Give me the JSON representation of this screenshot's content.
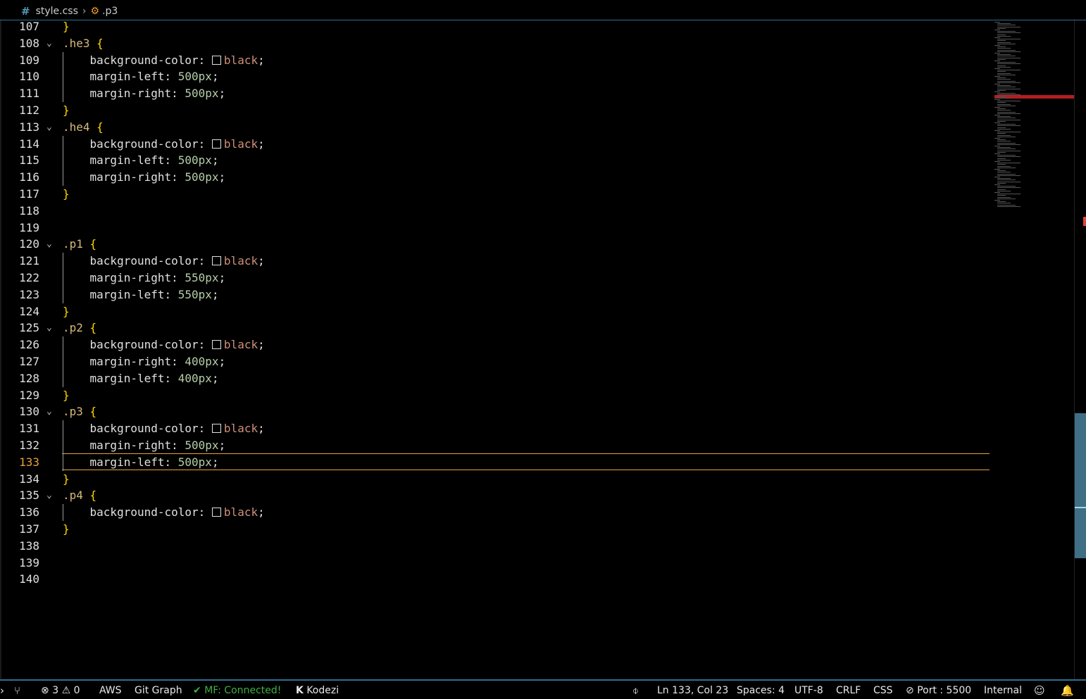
{
  "breadcrumb": {
    "file": "style.css",
    "symbol": ".p3",
    "file_icon": "hash-icon",
    "symbol_icon": "class-symbol-icon"
  },
  "editor": {
    "active_line": "133",
    "lines": [
      {
        "n": "107",
        "kind": "close"
      },
      {
        "n": "108",
        "kind": "open",
        "sel": ".he3"
      },
      {
        "n": "109",
        "kind": "bg",
        "prop": "background-color",
        "val": "black"
      },
      {
        "n": "110",
        "kind": "num",
        "prop": "margin-left",
        "val": "500px"
      },
      {
        "n": "111",
        "kind": "num",
        "prop": "margin-right",
        "val": "500px"
      },
      {
        "n": "112",
        "kind": "close"
      },
      {
        "n": "113",
        "kind": "open",
        "sel": ".he4"
      },
      {
        "n": "114",
        "kind": "bg",
        "prop": "background-color",
        "val": "black"
      },
      {
        "n": "115",
        "kind": "num",
        "prop": "margin-left",
        "val": "500px"
      },
      {
        "n": "116",
        "kind": "num",
        "prop": "margin-right",
        "val": "500px"
      },
      {
        "n": "117",
        "kind": "close"
      },
      {
        "n": "118",
        "kind": "blank"
      },
      {
        "n": "119",
        "kind": "blank"
      },
      {
        "n": "120",
        "kind": "open",
        "sel": ".p1"
      },
      {
        "n": "121",
        "kind": "bg",
        "prop": "background-color",
        "val": "black"
      },
      {
        "n": "122",
        "kind": "num",
        "prop": "margin-right",
        "val": "550px"
      },
      {
        "n": "123",
        "kind": "num",
        "prop": "margin-left",
        "val": "550px"
      },
      {
        "n": "124",
        "kind": "close"
      },
      {
        "n": "125",
        "kind": "open",
        "sel": ".p2"
      },
      {
        "n": "126",
        "kind": "bg",
        "prop": "background-color",
        "val": "black"
      },
      {
        "n": "127",
        "kind": "num",
        "prop": "margin-right",
        "val": "400px"
      },
      {
        "n": "128",
        "kind": "num",
        "prop": "margin-left",
        "val": "400px"
      },
      {
        "n": "129",
        "kind": "close"
      },
      {
        "n": "130",
        "kind": "open",
        "sel": ".p3"
      },
      {
        "n": "131",
        "kind": "bg",
        "prop": "background-color",
        "val": "black"
      },
      {
        "n": "132",
        "kind": "num",
        "prop": "margin-right",
        "val": "500px"
      },
      {
        "n": "133",
        "kind": "num",
        "prop": "margin-left",
        "val": "500px"
      },
      {
        "n": "134",
        "kind": "close"
      },
      {
        "n": "135",
        "kind": "open",
        "sel": ".p4"
      },
      {
        "n": "136",
        "kind": "bg",
        "prop": "background-color",
        "val": "black"
      },
      {
        "n": "137",
        "kind": "close"
      },
      {
        "n": "138",
        "kind": "blank"
      },
      {
        "n": "139",
        "kind": "blank"
      },
      {
        "n": "140",
        "kind": "blank"
      }
    ]
  },
  "statusbar": {
    "errors": "3",
    "warnings": "0",
    "aws": "AWS",
    "git_graph": "Git Graph",
    "mf_status": "MF: Connected!",
    "kodezi": "Kodezi",
    "position": "Ln 133, Col 23",
    "spaces": "Spaces: 4",
    "encoding": "UTF-8",
    "eol": "CRLF",
    "language": "CSS",
    "port": "Port : 5500",
    "internal": "Internal"
  },
  "colors": {
    "accent": "#2f6f8f",
    "cursor_line": "#e8a13a",
    "selector": "#d7ba7d",
    "brace": "#ffd700",
    "number": "#b5cea8",
    "value": "#ce9178",
    "status_green": "#3fae3f"
  }
}
